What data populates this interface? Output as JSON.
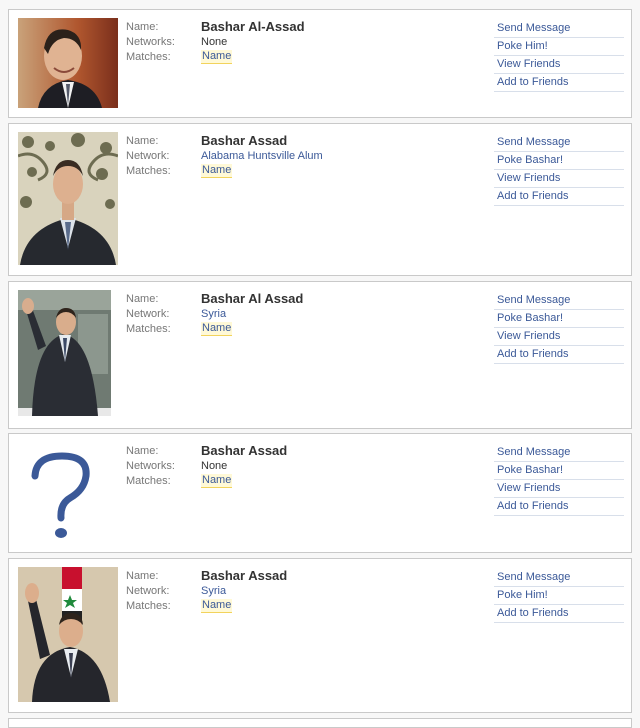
{
  "results": [
    {
      "name_label": "Name:",
      "name": "Bashar Al-Assad",
      "network_label": "Networks:",
      "network": "None",
      "matches_label": "Matches:",
      "matches": "Name",
      "actions": [
        "Send Message",
        "Poke Him!",
        "View Friends",
        "Add to Friends"
      ]
    },
    {
      "name_label": "Name:",
      "name": "Bashar Assad",
      "network_label": "Network:",
      "network": "Alabama Huntsville Alum",
      "matches_label": "Matches:",
      "matches": "Name",
      "actions": [
        "Send Message",
        "Poke Bashar!",
        "View Friends",
        "Add to Friends"
      ]
    },
    {
      "name_label": "Name:",
      "name": "Bashar Al Assad",
      "network_label": "Network:",
      "network": "Syria",
      "matches_label": "Matches:",
      "matches": "Name",
      "actions": [
        "Send Message",
        "Poke Bashar!",
        "View Friends",
        "Add to Friends"
      ]
    },
    {
      "name_label": "Name:",
      "name": "Bashar Assad",
      "network_label": "Networks:",
      "network": "None",
      "matches_label": "Matches:",
      "matches": "Name",
      "actions": [
        "Send Message",
        "Poke Bashar!",
        "View Friends",
        "Add to Friends"
      ]
    },
    {
      "name_label": "Name:",
      "name": "Bashar Assad",
      "network_label": "Network:",
      "network": "Syria",
      "matches_label": "Matches:",
      "matches": "Name",
      "actions": [
        "Send Message",
        "Poke Him!",
        "Add to Friends"
      ]
    }
  ],
  "colors": {
    "link": "#3b5998",
    "highlight": "#fff9d7",
    "border": "#c9c9c9"
  }
}
